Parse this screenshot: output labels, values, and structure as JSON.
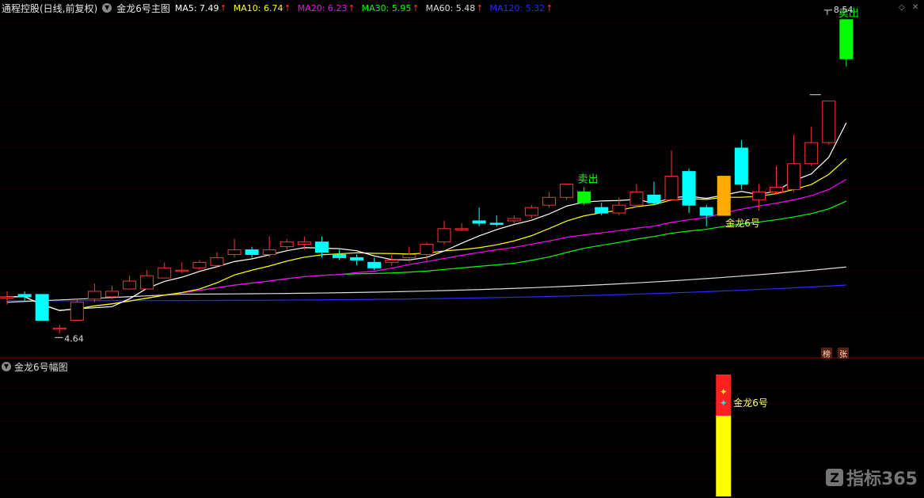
{
  "header": {
    "stock_title": "通程控股(日线,前复权)",
    "indicator_name": "金龙6号主图",
    "ma_readouts": [
      {
        "label": "MA5: 7.49",
        "color": "#ffffff"
      },
      {
        "label": "MA10: 6.74",
        "color": "#ffff00"
      },
      {
        "label": "MA20: 6.23",
        "color": "#ff00ff"
      },
      {
        "label": "MA30: 5.95",
        "color": "#00ff00"
      },
      {
        "label": "MA60: 5.48",
        "color": "#dddddd"
      },
      {
        "label": "MA120: 5.32",
        "color": "#2a2aff"
      }
    ],
    "up_arrow": "↑"
  },
  "sub_panel": {
    "title": "金龙6号幅图",
    "signal_label": "金龙6号"
  },
  "chart_data": {
    "type": "candlestick",
    "price_high_label": "8.54",
    "price_low_label": "4.64",
    "annotations": [
      "卖出",
      "卖出",
      "金龙6号"
    ],
    "candles": [
      {
        "o": 5.17,
        "c": 5.17,
        "h": 5.24,
        "l": 5.07,
        "up": true
      },
      {
        "o": 5.2,
        "c": 5.17,
        "h": 5.24,
        "l": 5.12,
        "up": false
      },
      {
        "o": 5.2,
        "c": 4.87,
        "h": 5.2,
        "l": 4.87,
        "up": false
      },
      {
        "o": 4.77,
        "c": 4.77,
        "h": 4.81,
        "l": 4.7,
        "up": true
      },
      {
        "o": 4.87,
        "c": 5.1,
        "h": 5.14,
        "l": 4.87,
        "up": true
      },
      {
        "o": 5.14,
        "c": 5.24,
        "h": 5.34,
        "l": 5.1,
        "up": true
      },
      {
        "o": 5.17,
        "c": 5.24,
        "h": 5.31,
        "l": 5.14,
        "up": true
      },
      {
        "o": 5.27,
        "c": 5.37,
        "h": 5.44,
        "l": 5.27,
        "up": true
      },
      {
        "o": 5.27,
        "c": 5.44,
        "h": 5.51,
        "l": 5.27,
        "up": true
      },
      {
        "o": 5.41,
        "c": 5.54,
        "h": 5.61,
        "l": 5.41,
        "up": true
      },
      {
        "o": 5.51,
        "c": 5.51,
        "h": 5.61,
        "l": 5.47,
        "up": true
      },
      {
        "o": 5.54,
        "c": 5.61,
        "h": 5.64,
        "l": 5.51,
        "up": true
      },
      {
        "o": 5.57,
        "c": 5.67,
        "h": 5.74,
        "l": 5.54,
        "up": true
      },
      {
        "o": 5.71,
        "c": 5.77,
        "h": 5.91,
        "l": 5.67,
        "up": true
      },
      {
        "o": 5.77,
        "c": 5.71,
        "h": 5.81,
        "l": 5.67,
        "up": false
      },
      {
        "o": 5.71,
        "c": 5.77,
        "h": 5.94,
        "l": 5.67,
        "up": true
      },
      {
        "o": 5.81,
        "c": 5.87,
        "h": 5.91,
        "l": 5.77,
        "up": true
      },
      {
        "o": 5.84,
        "c": 5.87,
        "h": 5.94,
        "l": 5.77,
        "up": true
      },
      {
        "o": 5.87,
        "c": 5.74,
        "h": 5.94,
        "l": 5.67,
        "up": false
      },
      {
        "o": 5.71,
        "c": 5.67,
        "h": 5.77,
        "l": 5.64,
        "up": false
      },
      {
        "o": 5.67,
        "c": 5.64,
        "h": 5.71,
        "l": 5.57,
        "up": false
      },
      {
        "o": 5.61,
        "c": 5.54,
        "h": 5.67,
        "l": 5.51,
        "up": false
      },
      {
        "o": 5.61,
        "c": 5.64,
        "h": 5.71,
        "l": 5.57,
        "up": true
      },
      {
        "o": 5.67,
        "c": 5.71,
        "h": 5.81,
        "l": 5.61,
        "up": true
      },
      {
        "o": 5.71,
        "c": 5.84,
        "h": 5.87,
        "l": 5.61,
        "up": true
      },
      {
        "o": 5.87,
        "c": 6.04,
        "h": 6.14,
        "l": 5.84,
        "up": true
      },
      {
        "o": 6.04,
        "c": 6.04,
        "h": 6.11,
        "l": 6.01,
        "up": true
      },
      {
        "o": 6.14,
        "c": 6.11,
        "h": 6.31,
        "l": 6.07,
        "up": false
      },
      {
        "o": 6.11,
        "c": 6.11,
        "h": 6.21,
        "l": 6.07,
        "up": false
      },
      {
        "o": 6.14,
        "c": 6.17,
        "h": 6.21,
        "l": 6.11,
        "up": true
      },
      {
        "o": 6.21,
        "c": 6.31,
        "h": 6.34,
        "l": 6.17,
        "up": true
      },
      {
        "o": 6.34,
        "c": 6.44,
        "h": 6.51,
        "l": 6.31,
        "up": true
      },
      {
        "o": 6.44,
        "c": 6.61,
        "h": 6.61,
        "l": 6.41,
        "up": true
      },
      {
        "o": 6.51,
        "c": 6.37,
        "h": 6.57,
        "l": 6.34,
        "up": false,
        "signal": "green"
      },
      {
        "o": 6.31,
        "c": 6.24,
        "h": 6.37,
        "l": 6.21,
        "up": false
      },
      {
        "o": 6.24,
        "c": 6.34,
        "h": 6.44,
        "l": 6.21,
        "up": true
      },
      {
        "o": 6.34,
        "c": 6.51,
        "h": 6.61,
        "l": 6.31,
        "up": true
      },
      {
        "o": 6.47,
        "c": 6.37,
        "h": 6.64,
        "l": 6.34,
        "up": false
      },
      {
        "o": 6.41,
        "c": 6.71,
        "h": 7.04,
        "l": 6.41,
        "up": true
      },
      {
        "o": 6.77,
        "c": 6.34,
        "h": 6.81,
        "l": 6.24,
        "up": false
      },
      {
        "o": 6.31,
        "c": 6.21,
        "h": 6.34,
        "l": 6.07,
        "up": false
      },
      {
        "o": 6.21,
        "c": 6.71,
        "h": 6.71,
        "l": 6.21,
        "up": true,
        "signal": "gold"
      },
      {
        "o": 7.07,
        "c": 6.61,
        "h": 7.17,
        "l": 6.54,
        "up": false
      },
      {
        "o": 6.41,
        "c": 6.51,
        "h": 6.61,
        "l": 6.27,
        "up": true
      },
      {
        "o": 6.51,
        "c": 6.57,
        "h": 6.84,
        "l": 6.47,
        "up": true
      },
      {
        "o": 6.54,
        "c": 6.87,
        "h": 7.24,
        "l": 6.51,
        "up": true
      },
      {
        "o": 6.87,
        "c": 7.14,
        "h": 7.34,
        "l": 6.84,
        "up": true
      },
      {
        "o": 7.14,
        "c": 7.67,
        "h": 7.67,
        "l": 7.11,
        "up": true
      },
      {
        "o": 8.21,
        "c": 8.71,
        "h": 8.71,
        "l": 8.11,
        "up": true,
        "signal": "green"
      }
    ]
  },
  "badges": [
    "榜",
    "张"
  ],
  "watermark": {
    "logo_char": "Z",
    "text": "指标365"
  },
  "colors": {
    "up": "#ff3232",
    "down": "#00ffff",
    "signal_green": "#00ff00",
    "gold": "#ffaa00",
    "grid": "#5a0000"
  }
}
